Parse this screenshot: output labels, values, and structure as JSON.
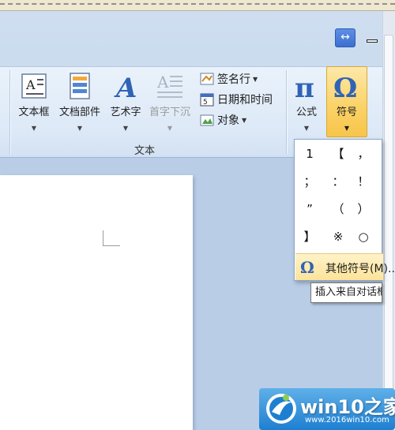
{
  "window": {
    "resize_icon": "↔"
  },
  "ribbon": {
    "group_text_label": "文本",
    "buttons": {
      "text_box": "文本框",
      "doc_parts": "文档部件",
      "word_art": "艺术字",
      "drop_cap": "首字下沉",
      "formula": "公式",
      "symbol": "符号"
    },
    "small_buttons": {
      "signature_line": "签名行",
      "date_time": "日期和时间",
      "object": "对象"
    },
    "icons": {
      "text_box": "text-box-icon",
      "doc_parts": "doc-parts-icon",
      "word_art": "word-art-icon",
      "drop_cap": "drop-cap-icon",
      "formula": "pi-icon",
      "symbol": "omega-icon",
      "signature_line": "signature-icon",
      "date_time": "calendar-icon",
      "object": "object-icon"
    }
  },
  "symbol_dropdown": {
    "symbols": [
      [
        "1",
        "【",
        "，"
      ],
      [
        "；",
        "：",
        "！"
      ],
      [
        "”",
        "（",
        "）"
      ],
      [
        "】",
        "※",
        "○"
      ]
    ],
    "more_symbols_label": "其他符号(M)..."
  },
  "tooltip": {
    "text": "插入来自对话框的符号"
  },
  "watermark": {
    "title": "win10之家",
    "url": "www.2016win10.com"
  },
  "colors": {
    "ribbon_bg": "#dde9f7",
    "active_button": "#fbd36a",
    "accent": "#2f63b5"
  }
}
